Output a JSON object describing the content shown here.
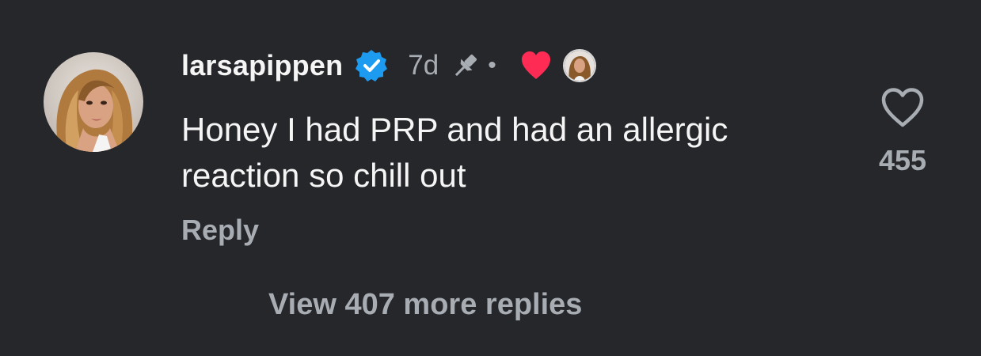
{
  "comment": {
    "username": "larsapippen",
    "verified": true,
    "timestamp": "7d",
    "pinned": true,
    "separator": "•",
    "liked_by_creator": true,
    "text": "Honey I had PRP and had an allergic reaction so chill out",
    "reply_label": "Reply",
    "like_count": "455"
  },
  "replies": {
    "view_more_label": "View 407 more replies"
  },
  "icons": {
    "verified": "verified-badge-icon",
    "pin": "pin-icon",
    "creator_heart": "heart-filled-icon",
    "like": "heart-outline-icon"
  },
  "colors": {
    "background": "#26272b",
    "primary_text": "#f5f5f5",
    "secondary_text": "#a8acb3",
    "verified_blue": "#1d9bf0",
    "heart_red": "#fe2c55"
  }
}
